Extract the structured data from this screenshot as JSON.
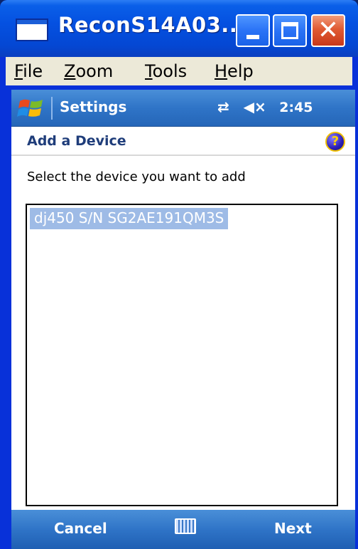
{
  "window": {
    "title": "ReconS14A03...",
    "minimize_icon": "minimize-icon",
    "maximize_icon": "maximize-icon",
    "close_icon": "close-icon",
    "close_glyph": "✕"
  },
  "menu": {
    "items": [
      {
        "accel": "F",
        "rest": "ile"
      },
      {
        "accel": "Z",
        "rest": "oom"
      },
      {
        "accel": "T",
        "rest": "ools"
      },
      {
        "accel": "H",
        "rest": "elp"
      }
    ]
  },
  "nav": {
    "title": "Settings",
    "connectivity_glyph": "⇄",
    "volume_glyph": "◀×",
    "time": "2:45",
    "start_icon": "windows-flag-icon"
  },
  "page": {
    "title": "Add a Device",
    "help_glyph": "?",
    "instruction": "Select the device you want to add"
  },
  "devices": [
    {
      "label": "dj450 S/N SG2AE191QM3S",
      "selected": true
    }
  ],
  "softkeys": {
    "left": "Cancel",
    "right": "Next",
    "center_icon": "keyboard-icon"
  },
  "colors": {
    "titlebar": "#0551e1",
    "menubar": "#ece9d8",
    "navbar": "#2f74c7",
    "selection": "#9ebbe6",
    "page_title": "#1f3d7a"
  }
}
